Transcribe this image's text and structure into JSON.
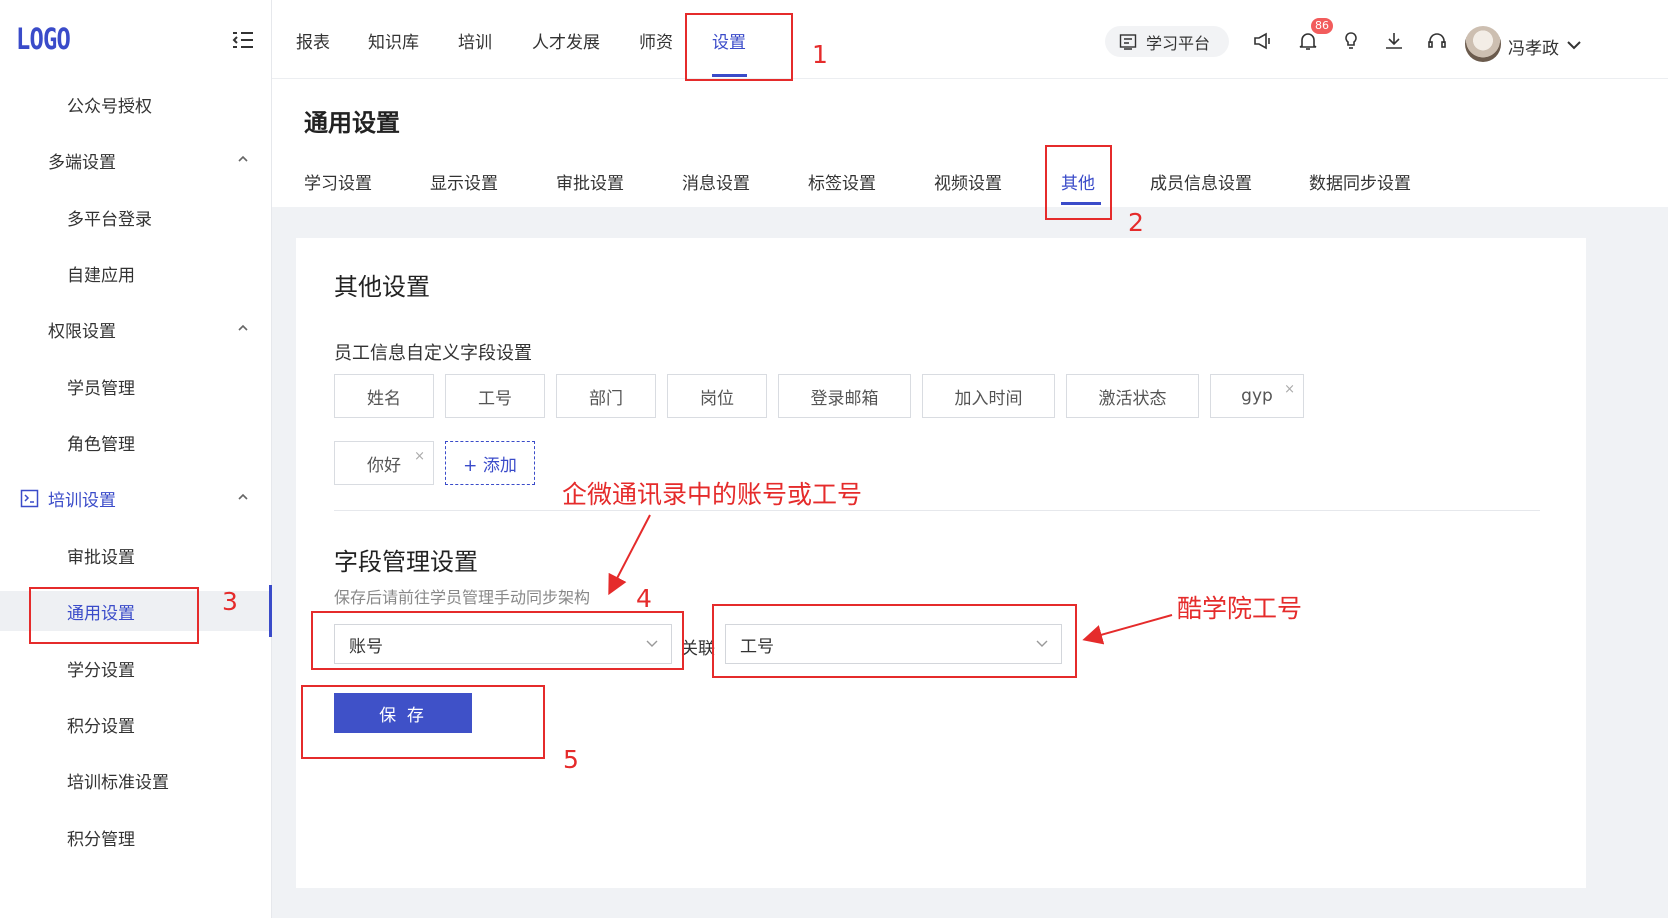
{
  "logo": "LOGO",
  "sidebar": {
    "items": [
      {
        "label": "公众号授权"
      },
      {
        "label": "多端设置"
      },
      {
        "label": "多平台登录"
      },
      {
        "label": "自建应用"
      },
      {
        "label": "权限设置"
      },
      {
        "label": "学员管理"
      },
      {
        "label": "角色管理"
      },
      {
        "label": "培训设置"
      },
      {
        "label": "审批设置"
      },
      {
        "label": "通用设置"
      },
      {
        "label": "学分设置"
      },
      {
        "label": "积分设置"
      },
      {
        "label": "培训标准设置"
      },
      {
        "label": "积分管理"
      }
    ],
    "active_item": "通用设置"
  },
  "header": {
    "tabs": [
      "报表",
      "知识库",
      "培训",
      "人才发展",
      "师资",
      "设置"
    ],
    "active_tab": "设置",
    "platform_button": "学习平台",
    "notification_count": "86",
    "username": "冯孝政"
  },
  "page": {
    "title": "通用设置",
    "sub_tabs": [
      "学习设置",
      "显示设置",
      "审批设置",
      "消息设置",
      "标签设置",
      "视频设置",
      "其他",
      "成员信息设置",
      "数据同步设置"
    ],
    "active_sub_tab": "其他"
  },
  "card": {
    "title": "其他设置",
    "custom_fields_label": "员工信息自定义字段设置",
    "fields": [
      {
        "label": "姓名",
        "removable": false
      },
      {
        "label": "工号",
        "removable": false
      },
      {
        "label": "部门",
        "removable": false
      },
      {
        "label": "岗位",
        "removable": false
      },
      {
        "label": "登录邮箱",
        "removable": false
      },
      {
        "label": "加入时间",
        "removable": false
      },
      {
        "label": "激活状态",
        "removable": false
      },
      {
        "label": "gyp",
        "removable": true
      },
      {
        "label": "你好",
        "removable": true
      }
    ],
    "remove_glyph": "×",
    "add_button": "+ 添加",
    "mgmt_title": "字段管理设置",
    "mgmt_tip": "保存后请前往学员管理手动同步架构",
    "left_select_value": "账号",
    "link_label": "关联",
    "right_select_value": "工号",
    "save_button": "保 存"
  },
  "annotations": {
    "numbers": [
      "1",
      "2",
      "3",
      "4",
      "5"
    ],
    "note_wecom": "企微通讯录中的账号或工号",
    "note_kuxueyuan": "酷学院工号"
  },
  "colors": {
    "accent": "#3a4bc9",
    "annotation": "#e52b2b",
    "badge": "#f25c5c"
  }
}
